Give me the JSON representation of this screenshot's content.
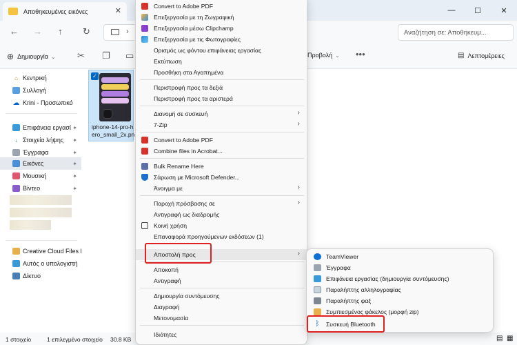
{
  "window": {
    "tab_title": "Αποθηκευμένες εικόνες",
    "tab_close": "✕",
    "minimize": "—",
    "maximize": "☐",
    "close": "✕"
  },
  "navbar": {
    "search_placeholder": "Αναζήτηση σε: Αποθηκευμ..."
  },
  "cmdbar": {
    "create_label": "Δημιουργία",
    "view_label": "Προβολή",
    "details_label": "Λεπτομέρειες"
  },
  "sidebar": {
    "items": [
      {
        "label": "Κεντρική"
      },
      {
        "label": "Συλλογή"
      },
      {
        "label": "Krini - Προσωπικό"
      },
      {
        "label": "Επιφάνεια εργασί"
      },
      {
        "label": "Στοιχεία λήψης"
      },
      {
        "label": "Έγγραφα"
      },
      {
        "label": "Εικόνες"
      },
      {
        "label": "Μουσική"
      },
      {
        "label": "Βίντεο"
      },
      {
        "label": "Creative Cloud Files F"
      },
      {
        "label": "Αυτός ο υπολογιστή"
      },
      {
        "label": "Δίκτυο"
      }
    ]
  },
  "file": {
    "name": "iphone-14-pro-h ero_small_2x.pn"
  },
  "status": {
    "count": "1 στοιχείο",
    "selected": "1 επιλεγμένο στοιχείο",
    "size": "30.8 KB"
  },
  "context_menu": {
    "items": [
      {
        "label": "Convert to Adobe PDF"
      },
      {
        "label": "Επεξεργασία με τη Ζωγραφική"
      },
      {
        "label": "Επεξεργασία μέσω Clipchamp"
      },
      {
        "label": "Επεξεργασία με τις Φωτογραφίες"
      },
      {
        "label": "Ορισμός ως φόντου επιφάνειας εργασίας"
      },
      {
        "label": "Εκτύπωση"
      },
      {
        "label": "Προσθήκη στα Αγαπημένα"
      },
      {
        "label": "Περιστροφή προς τα δεξιά"
      },
      {
        "label": "Περιστροφή προς τα αριστερά"
      },
      {
        "label": "Διανομή σε συσκευή"
      },
      {
        "label": "7-Zip"
      },
      {
        "label": "Convert to Adobe PDF"
      },
      {
        "label": "Combine files in Acrobat..."
      },
      {
        "label": "Bulk Rename Here"
      },
      {
        "label": "Σάρωση με Microsoft Defender..."
      },
      {
        "label": "Άνοιγμα με"
      },
      {
        "label": "Παροχή πρόσβασης σε"
      },
      {
        "label": "Αντιγραφή ως διαδρομής"
      },
      {
        "label": "Κοινή χρήση"
      },
      {
        "label": "Επαναφορά προηγούμενων εκδόσεων (1)"
      },
      {
        "label": "Αποστολή προς"
      },
      {
        "label": "Αποκοπή"
      },
      {
        "label": "Αντιγραφή"
      },
      {
        "label": "Δημιουργία συντόμευσης"
      },
      {
        "label": "Διαγραφή"
      },
      {
        "label": "Μετονομασία"
      },
      {
        "label": "Ιδιότητες"
      }
    ]
  },
  "submenu": {
    "items": [
      {
        "label": "TeamViewer"
      },
      {
        "label": "Έγγραφα"
      },
      {
        "label": "Επιφάνεια εργασίας (δημιουργία συντόμευσης)"
      },
      {
        "label": "Παραλήπτης αλληλογραφίας"
      },
      {
        "label": "Παραλήπτης φαξ"
      },
      {
        "label": "Συμπιεσμένος φάκελος (μορφή zip)"
      },
      {
        "label": "Συσκευή Bluetooth"
      }
    ]
  },
  "colors": {
    "accent": "#0067c0",
    "highlight_box": "#e02020",
    "selection": "#cce4f7"
  }
}
